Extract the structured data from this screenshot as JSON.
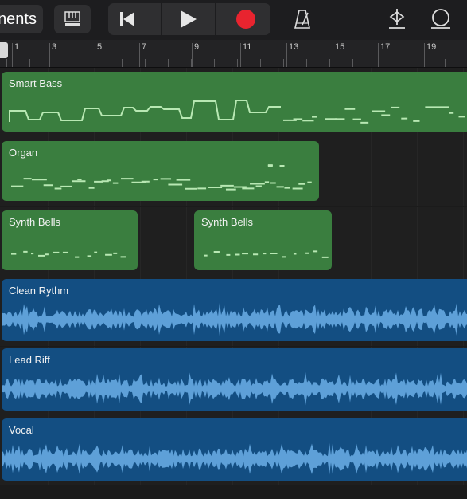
{
  "toolbar": {
    "instruments_label": "nents",
    "mixer_icon": "track-view-icon",
    "rewind_icon": "skip-back-icon",
    "play_icon": "play-icon",
    "record_icon": "record-icon",
    "metronome_icon": "metronome-icon",
    "master_icon": "master-volume-icon",
    "loop_icon": "loop-browser-icon",
    "record_color": "#e8242f"
  },
  "ruler": {
    "bar_numbers": [
      "1",
      "3",
      "5",
      "7",
      "9",
      "11",
      "13",
      "15",
      "17",
      "19"
    ]
  },
  "tracks": [
    {
      "name": "Smart Bass",
      "type": "midi",
      "color": "#3a7e3f",
      "regions": [
        {
          "title": "Smart Bass"
        }
      ]
    },
    {
      "name": "Organ",
      "type": "midi",
      "color": "#3a7e3f",
      "regions": [
        {
          "title": "Organ"
        }
      ]
    },
    {
      "name": "Synth Bells",
      "type": "midi",
      "color": "#3a7e3f",
      "regions": [
        {
          "title": "Synth Bells"
        },
        {
          "title": "Synth Bells"
        }
      ]
    },
    {
      "name": "Clean Rythm",
      "type": "audio",
      "color": "#134e82",
      "regions": [
        {
          "title": "Clean Rythm"
        }
      ]
    },
    {
      "name": "Lead Riff",
      "type": "audio",
      "color": "#134e82",
      "regions": [
        {
          "title": "Lead Riff"
        }
      ]
    },
    {
      "name": "Vocal",
      "type": "audio",
      "color": "#134e82",
      "regions": [
        {
          "title": "Vocal"
        }
      ]
    }
  ]
}
